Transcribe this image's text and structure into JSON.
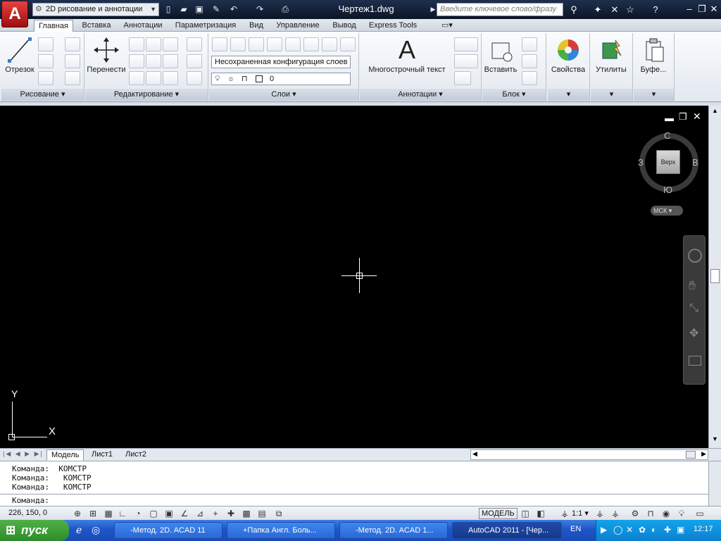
{
  "title_bar": {
    "app_logo": "A",
    "workspace": "2D рисование и аннотации",
    "document_title": "Чертеж1.dwg",
    "search_placeholder": "Введите ключевое слово/фразу"
  },
  "ribbon_tabs": [
    "Главная",
    "Вставка",
    "Аннотации",
    "Параметризация",
    "Вид",
    "Управление",
    "Вывод",
    "Express Tools"
  ],
  "ribbon": {
    "panels": {
      "draw": "Рисование",
      "modify": "Редактирование",
      "layers": "Слои",
      "annotations": "Аннотации",
      "block": "Блок"
    },
    "draw": {
      "line": "Отрезок"
    },
    "modify": {
      "move": "Перенести"
    },
    "layers": {
      "config": "Несохраненная конфигурация слоев",
      "current_layer": "0"
    },
    "annotations": {
      "mtext": "Многострочный текст",
      "mtext_glyph": "A"
    },
    "block": {
      "insert": "Вставить"
    },
    "properties": "Свойства",
    "utilities": "Утилиты",
    "clipboard": "Буфе..."
  },
  "viewcube": {
    "north": "С",
    "south": "Ю",
    "west": "З",
    "east": "В",
    "face": "Верх",
    "ucs": "МСК"
  },
  "ucs_icon": {
    "x": "X",
    "y": "Y"
  },
  "layout_tabs": [
    "Модель",
    "Лист1",
    "Лист2"
  ],
  "command_history": [
    "Команда:  КОМСТР",
    "Команда:   КОМСТР",
    "Команда:   КОМСТР"
  ],
  "command_prompt": "Команда:",
  "status_bar": {
    "coordinates": "226, 150, 0",
    "model": "МОДЕЛЬ",
    "scale": "1:1"
  },
  "taskbar": {
    "start": "пуск",
    "tasks": [
      "-Метод. 2D. ACAD 11",
      "+Папка Англ. Боль...",
      "-Метод. 2D. ACAD 1...",
      "AutoCAD 2011 - [Чер..."
    ],
    "lang": "EN",
    "clock": "12:17"
  },
  "colors": {
    "canvas": "#000000",
    "title_bar": "#16223a",
    "logo": "#d32525",
    "taskbar": "#245edb",
    "start": "#3c9a35"
  }
}
